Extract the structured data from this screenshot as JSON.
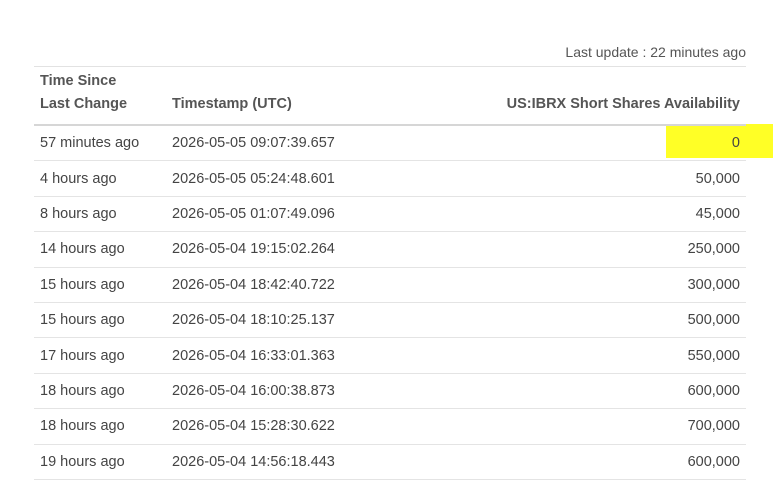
{
  "last_update": "Last update : 22 minutes ago",
  "headers": {
    "since_line1": "Time Since",
    "since_line2": "Last Change",
    "timestamp": "Timestamp (UTC)",
    "availability": "US:IBRX Short Shares Availability"
  },
  "highlight_color": "#ffff00",
  "rows": [
    {
      "since": "57 minutes ago",
      "timestamp": "2026-05-05 09:07:39.657",
      "shares": "0"
    },
    {
      "since": "4 hours ago",
      "timestamp": "2026-05-05 05:24:48.601",
      "shares": "50,000"
    },
    {
      "since": "8 hours ago",
      "timestamp": "2026-05-05 01:07:49.096",
      "shares": "45,000"
    },
    {
      "since": "14 hours ago",
      "timestamp": "2026-05-04 19:15:02.264",
      "shares": "250,000"
    },
    {
      "since": "15 hours ago",
      "timestamp": "2026-05-04 18:42:40.722",
      "shares": "300,000"
    },
    {
      "since": "15 hours ago",
      "timestamp": "2026-05-04 18:10:25.137",
      "shares": "500,000"
    },
    {
      "since": "17 hours ago",
      "timestamp": "2026-05-04 16:33:01.363",
      "shares": "550,000"
    },
    {
      "since": "18 hours ago",
      "timestamp": "2026-05-04 16:00:38.873",
      "shares": "600,000"
    },
    {
      "since": "18 hours ago",
      "timestamp": "2026-05-04 15:28:30.622",
      "shares": "700,000"
    },
    {
      "since": "19 hours ago",
      "timestamp": "2026-05-04 14:56:18.443",
      "shares": "600,000"
    }
  ]
}
